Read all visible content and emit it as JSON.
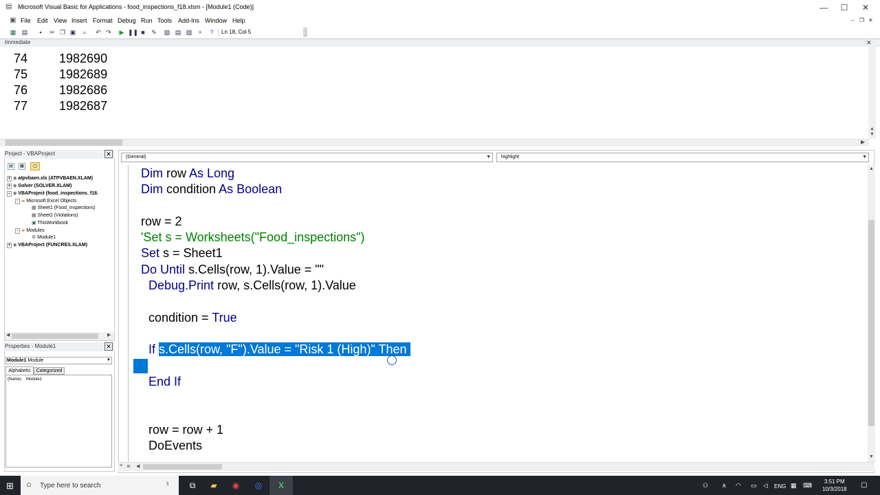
{
  "window": {
    "title": "Microsoft Visual Basic for Applications - food_inspections_f18.xlsm - [Module1 (Code)]",
    "controls": {
      "minimize": "—",
      "maximize": "☐",
      "close": "✕"
    }
  },
  "menubar": {
    "items": [
      "File",
      "Edit",
      "View",
      "Insert",
      "Format",
      "Debug",
      "Run",
      "Tools",
      "Add-Ins",
      "Window",
      "Help"
    ]
  },
  "toolbar": {
    "position": "Ln 18, Col 5"
  },
  "immediate": {
    "title": "Immediate",
    "rows": [
      {
        "row": "74",
        "value": "1982690"
      },
      {
        "row": "75",
        "value": "1982689"
      },
      {
        "row": "76",
        "value": "1982686"
      },
      {
        "row": "77",
        "value": "1982687"
      }
    ]
  },
  "project": {
    "title": "Project - VBAProject",
    "tree": [
      {
        "label": "atpvbaen.xls (ATPVBAEN.XLAM)",
        "level": 0,
        "bold": true,
        "expander": "+"
      },
      {
        "label": "Solver (SOLVER.XLAM)",
        "level": 0,
        "bold": true,
        "expander": "+"
      },
      {
        "label": "VBAProject (food_inspections_f18.",
        "level": 0,
        "bold": true,
        "expander": "−"
      },
      {
        "label": "Microsoft Excel Objects",
        "level": 1,
        "bold": false,
        "expander": "−"
      },
      {
        "label": "Sheet1 (Food_Inspections)",
        "level": 2,
        "bold": false,
        "expander": ""
      },
      {
        "label": "Sheet2 (Violations)",
        "level": 2,
        "bold": false,
        "expander": ""
      },
      {
        "label": "ThisWorkbook",
        "level": 2,
        "bold": false,
        "expander": ""
      },
      {
        "label": "Modules",
        "level": 1,
        "bold": false,
        "expander": "−"
      },
      {
        "label": "Module1",
        "level": 2,
        "bold": false,
        "expander": ""
      },
      {
        "label": "VBAProject (FUNCRES.XLAM)",
        "level": 0,
        "bold": true,
        "expander": "+"
      }
    ]
  },
  "properties": {
    "title": "Properties - Module1",
    "object": "Module1",
    "object_type": "Module",
    "tabs": [
      "Alphabetic",
      "Categorized"
    ],
    "rows": [
      {
        "name": "(Name)",
        "value": "Module1"
      }
    ]
  },
  "code": {
    "object_combo": "(General)",
    "procedure_combo": "highlight",
    "lines": {
      "l1_kw": "Dim",
      "l1_rest": " row ",
      "l1_kw2": "As Long",
      "l2_kw": "Dim",
      "l2_rest": " condition ",
      "l2_kw2": "As Boolean",
      "l3": "row = 2",
      "l4_comment": "'Set s = Worksheets(\"Food_inspections\")",
      "l5_kw": "Set",
      "l5_rest": " s = Sheet1",
      "l6_kw": "Do Until",
      "l6_rest": " s.Cells(row, 1).Value = \"\"",
      "l7_kw": "Debug.Print",
      "l7_rest": " row, s.Cells(row, 1).Value",
      "l8_rest": "condition = ",
      "l8_kw": "True",
      "l9_kw": "If",
      "l9_sel": "s.Cells(row, \"F\").Value = \"Risk 1 (High)\" Then ",
      "l10_kw": "End If",
      "l11": "row = row + 1",
      "l12": "DoEvents"
    }
  },
  "taskbar": {
    "search_placeholder": "Type here to search",
    "language": "ENG",
    "time": "3:51 PM",
    "date": "10/3/2018"
  }
}
